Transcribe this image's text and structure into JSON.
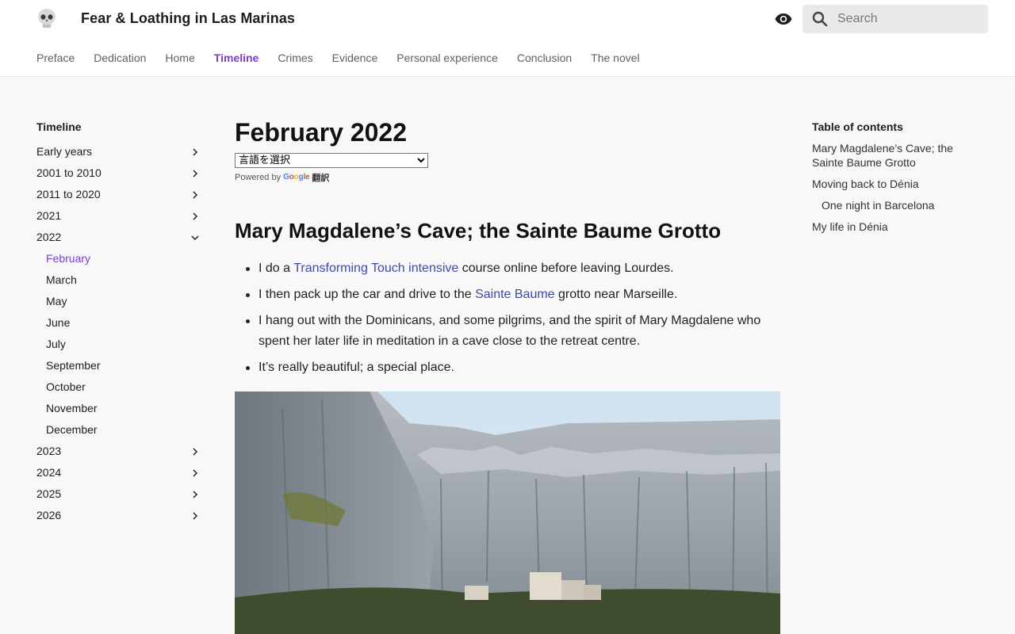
{
  "header": {
    "site_title": "Fear & Loathing in Las Marinas",
    "logo_icon": "skull-icon",
    "theme_icon": "eye-icon",
    "search": {
      "placeholder": "Search",
      "value": "",
      "icon": "search-icon"
    }
  },
  "topnav": {
    "items": [
      {
        "label": "Preface"
      },
      {
        "label": "Dedication"
      },
      {
        "label": "Home"
      },
      {
        "label": "Timeline",
        "active": true
      },
      {
        "label": "Crimes"
      },
      {
        "label": "Evidence"
      },
      {
        "label": "Personal experience"
      },
      {
        "label": "Conclusion"
      },
      {
        "label": "The novel"
      }
    ]
  },
  "sidebar": {
    "title": "Timeline",
    "items": [
      {
        "label": "Early years",
        "icon": "chevron-right-icon"
      },
      {
        "label": "2001 to 2010",
        "icon": "chevron-right-icon"
      },
      {
        "label": "2011 to 2020",
        "icon": "chevron-right-icon"
      },
      {
        "label": "2021",
        "icon": "chevron-right-icon"
      },
      {
        "label": "2022",
        "icon": "chevron-down-icon",
        "expanded": true
      },
      {
        "label": "2023",
        "icon": "chevron-right-icon"
      },
      {
        "label": "2024",
        "icon": "chevron-right-icon"
      },
      {
        "label": "2025",
        "icon": "chevron-right-icon"
      },
      {
        "label": "2026",
        "icon": "chevron-right-icon"
      }
    ],
    "months_2022": [
      {
        "label": "February",
        "current": true
      },
      {
        "label": "March"
      },
      {
        "label": "May"
      },
      {
        "label": "June"
      },
      {
        "label": "July"
      },
      {
        "label": "September"
      },
      {
        "label": "October"
      },
      {
        "label": "November"
      },
      {
        "label": "December"
      }
    ]
  },
  "main": {
    "title": "February 2022",
    "translate": {
      "select_value": "言語を選択",
      "powered_by": "Powered by",
      "google": "Google",
      "translate_word": "翻訳"
    },
    "section_heading": "Mary Magdalene’s Cave; the Sainte Baume Grotto",
    "bullets": {
      "b1_pre": "I do a ",
      "b1_link": "Transforming Touch intensive",
      "b1_post": " course online before leaving Lourdes.",
      "b2_pre": "I then pack up the car and drive to the ",
      "b2_link": "Sainte Baume",
      "b2_post": " grotto near Marseille.",
      "b3": "I hang out with the Dominicans, and some pilgrims, and the spirit of Mary Magdalene who spent her later life in meditation in a cave close to the retreat centre.",
      "b4": "It’s really beautiful; a special place."
    },
    "photo_subject": "limestone cliff with retreat building"
  },
  "toc": {
    "title": "Table of contents",
    "items": [
      {
        "label": "Mary Magdalene’s Cave; the Sainte Baume Grotto"
      },
      {
        "label": "Moving back to Dénia"
      },
      {
        "label": "One night in Barcelona"
      },
      {
        "label": "My life in Dénia"
      }
    ]
  },
  "colors": {
    "accent": "#7b3fd0",
    "link": "#3e4aa8",
    "background": "#f8f8f8",
    "header": "#ffffff"
  }
}
